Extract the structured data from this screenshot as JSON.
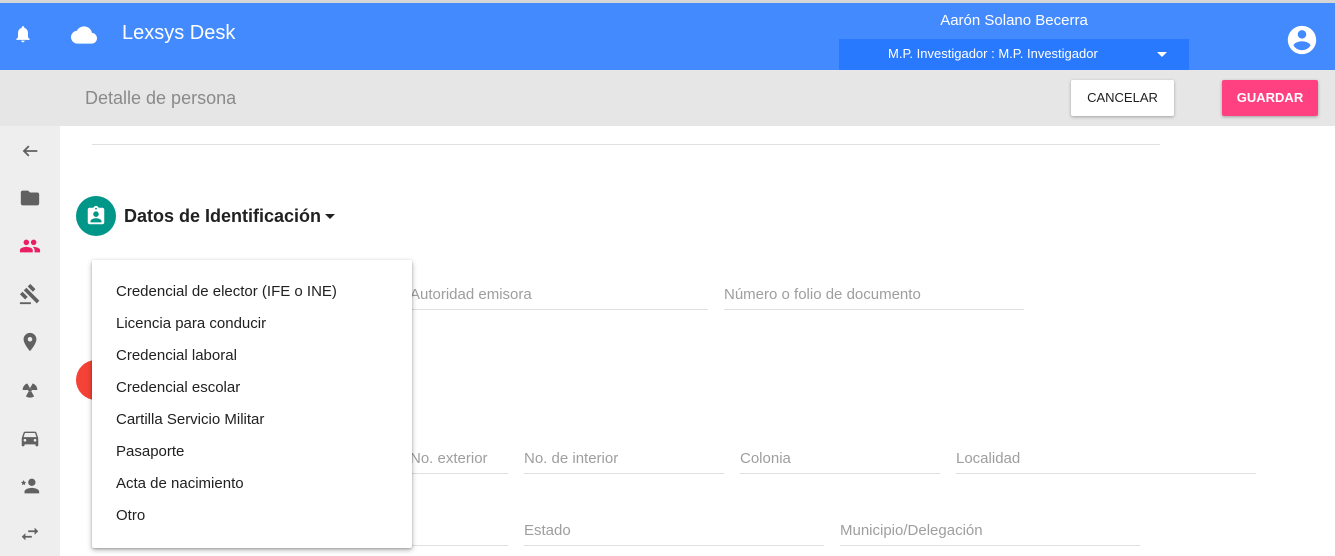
{
  "header": {
    "app_title": "Lexsys Desk",
    "user_name": "Aarón Solano Becerra",
    "role": "M.P. Investigador : M.P. Investigador",
    "icons": [
      "bell-icon",
      "cloud-icon",
      "account-circle-icon"
    ]
  },
  "toolbar": {
    "page_title": "Detalle de persona",
    "cancel_label": "CANCELAR",
    "save_label": "GUARDAR"
  },
  "sidebar": {
    "items": [
      {
        "icon": "back-arrow-icon"
      },
      {
        "icon": "folder-icon"
      },
      {
        "icon": "people-icon",
        "active": true
      },
      {
        "icon": "gavel-icon"
      },
      {
        "icon": "location-pin-icon"
      },
      {
        "icon": "radioactive-icon"
      },
      {
        "icon": "car-icon"
      },
      {
        "icon": "person-star-icon"
      },
      {
        "icon": "swap-arrows-icon"
      }
    ]
  },
  "section": {
    "title": "Datos de Identificación"
  },
  "fields": {
    "autoridad": {
      "placeholder": "Autoridad emisora",
      "value": ""
    },
    "folio": {
      "placeholder": "Número o folio de documento",
      "value": ""
    },
    "no_exterior": {
      "placeholder": "No. exterior",
      "value": ""
    },
    "no_interior": {
      "placeholder": "No. de interior",
      "value": ""
    },
    "colonia": {
      "placeholder": "Colonia",
      "value": ""
    },
    "localidad": {
      "placeholder": "Localidad",
      "value": ""
    },
    "estado": {
      "placeholder": "Estado",
      "value": ""
    },
    "municipio": {
      "placeholder": "Municipio/Delegación",
      "value": ""
    }
  },
  "dropdown": {
    "options": [
      "Credencial de elector (IFE o INE)",
      "Licencia para conducir",
      "Credencial laboral",
      "Credencial escolar",
      "Cartilla Servicio Militar",
      "Pasaporte",
      "Acta de nacimiento",
      "Otro"
    ]
  },
  "colors": {
    "header": "#448aff",
    "role_select": "#2979ff",
    "accent": "#ff4081",
    "section_icon": "#009688",
    "sidebar_active": "#e91e63"
  }
}
